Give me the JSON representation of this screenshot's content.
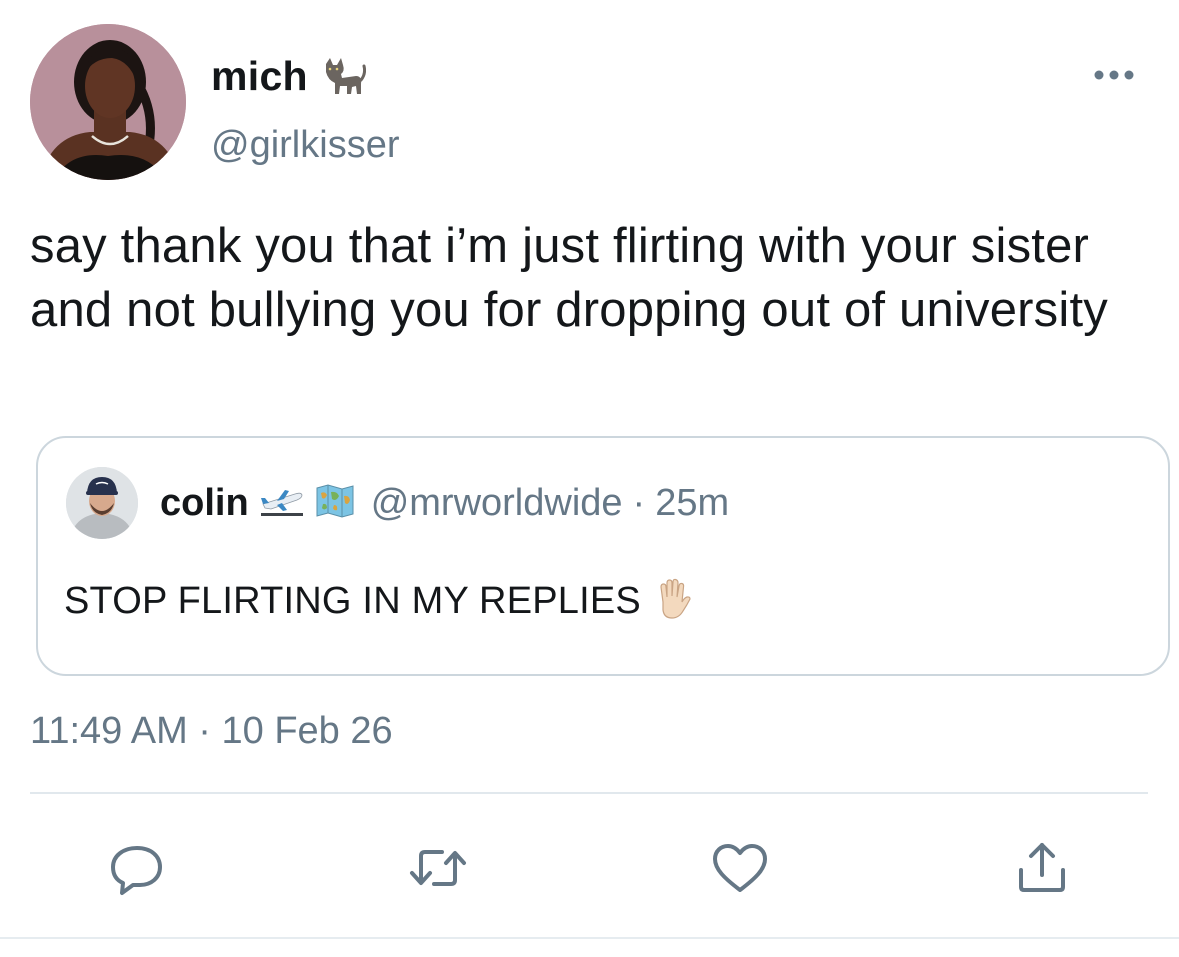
{
  "tweet": {
    "author": {
      "display_name": "mich",
      "name_emoji": "cat-emoji",
      "handle": "@girlkisser",
      "avatar": "avatar-photo"
    },
    "text": "say thank you that i’m just flirting with your sister and not bullying you for dropping out of university",
    "more_icon": "more-horizontal-icon",
    "quoted": {
      "display_name": "colin",
      "name_emojis": [
        "airplane-departure-emoji",
        "world-map-emoji"
      ],
      "handle": "@mrworldwide",
      "separator": "·",
      "time": "25m",
      "text": "STOP FLIRTING IN MY REPLIES",
      "text_emoji": "raised-hand-emoji"
    },
    "timestamp": {
      "time": "11:49 AM",
      "separator": "·",
      "date": "10 Feb 26"
    },
    "actions": [
      {
        "name": "reply",
        "icon": "reply-icon"
      },
      {
        "name": "retweet",
        "icon": "retweet-icon"
      },
      {
        "name": "like",
        "icon": "heart-icon"
      },
      {
        "name": "share",
        "icon": "share-icon"
      }
    ],
    "colors": {
      "primary_text": "#14171a",
      "secondary_text": "#657786",
      "border": "#ccd6dd",
      "icon": "#657786"
    }
  }
}
